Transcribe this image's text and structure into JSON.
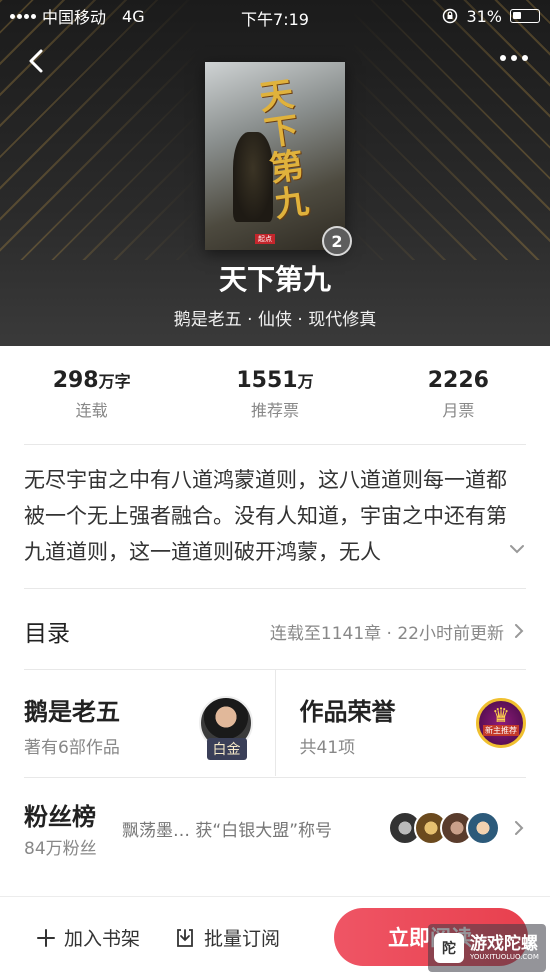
{
  "status_bar": {
    "carrier": "中国移动",
    "network": "4G",
    "time": "下午7:19",
    "battery": "31%"
  },
  "book": {
    "title": "天下第九",
    "meta": "鹅是老五 · 仙侠 · 现代修真",
    "cover_title": "天下第九",
    "badge": "2"
  },
  "stats": [
    {
      "value": "298",
      "unit": "万字",
      "label": "连载"
    },
    {
      "value": "1551",
      "unit": "万",
      "label": "推荐票"
    },
    {
      "value": "2226",
      "unit": "",
      "label": "月票"
    }
  ],
  "synopsis": "无尽宇宙之中有八道鸿蒙道则，这八道道则每一道都被一个无上强者融合。没有人知道，宇宙之中还有第九道道则，这一道道则破开鸿蒙，无人",
  "toc": {
    "title": "目录",
    "info": "连载至1141章 · 22小时前更新"
  },
  "author_card": {
    "name": "鹅是老五",
    "works": "著有6部作品",
    "tag": "白金"
  },
  "honor_card": {
    "title": "作品荣誉",
    "count": "共41项"
  },
  "fans": {
    "title": "粉丝榜",
    "count": "84万粉丝",
    "news": "飘荡墨… 获“白银大盟”称号"
  },
  "bottom_bar": {
    "add_shelf": "加入书架",
    "batch_subscribe": "批量订阅",
    "read_now": "立即阅读"
  },
  "watermark": {
    "text": "游戏陀螺"
  },
  "colors": {
    "accent": "#e8404e",
    "gold": "#e0b23c"
  }
}
